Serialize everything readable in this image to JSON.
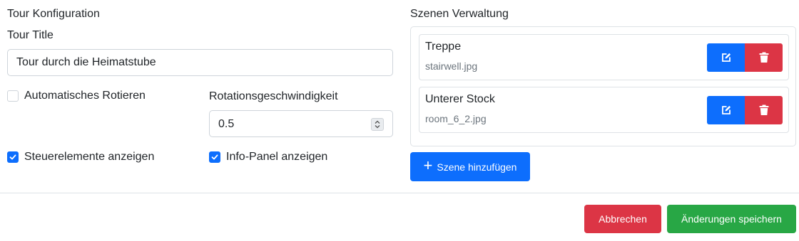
{
  "config": {
    "heading": "Tour Konfiguration",
    "title_label": "Tour Title",
    "title_value": "Tour durch die Heimatstube",
    "auto_rotate_label": "Automatisches Rotieren",
    "auto_rotate_checked": false,
    "rotation_speed_label": "Rotationsgeschwindigkeit",
    "rotation_speed_value": "0.5",
    "show_controls_label": "Steuerelemente anzeigen",
    "show_controls_checked": true,
    "info_panel_label": "Info-Panel anzeigen",
    "info_panel_checked": true
  },
  "scenes": {
    "heading": "Szenen Verwaltung",
    "items": [
      {
        "name": "Treppe",
        "file": "stairwell.jpg"
      },
      {
        "name": "Unterer Stock",
        "file": "room_6_2.jpg"
      }
    ],
    "add_label": "Szene hinzufügen"
  },
  "footer": {
    "cancel_label": "Abbrechen",
    "save_label": "Änderungen speichern"
  },
  "colors": {
    "primary": "#0d6efd",
    "danger": "#dc3545",
    "success": "#28a745"
  },
  "icons": {
    "edit": "edit-icon",
    "delete": "trash-icon",
    "add": "plus-icon"
  }
}
